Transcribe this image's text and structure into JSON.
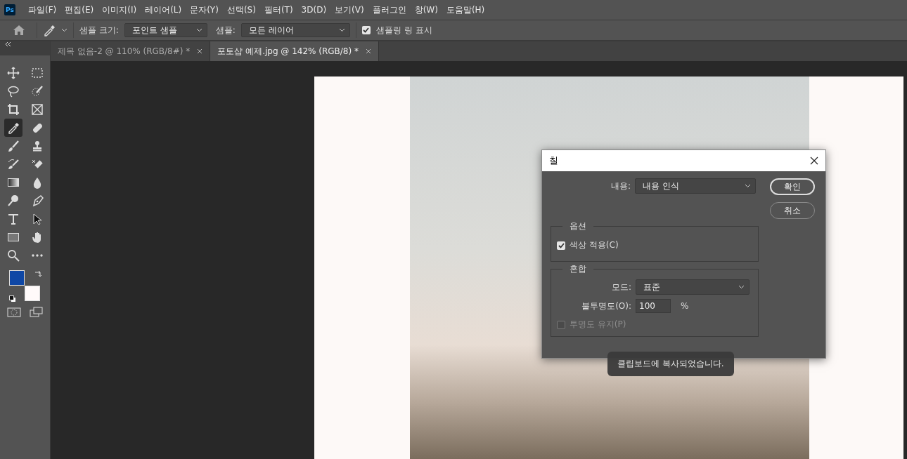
{
  "app_logo": "Ps",
  "menu": [
    "파일(F)",
    "편집(E)",
    "이미지(I)",
    "레이어(L)",
    "문자(Y)",
    "선택(S)",
    "필터(T)",
    "3D(D)",
    "보기(V)",
    "플러그인",
    "창(W)",
    "도움말(H)"
  ],
  "options_bar": {
    "sample_size_label": "샘플 크기:",
    "sample_size": "포인트 샘플",
    "sample_label": "샘플:",
    "sample": "모든 레이어",
    "show_ring": {
      "label": "샘플링 링 표시",
      "checked": true
    }
  },
  "tabs": [
    {
      "label": "제목 없음-2 @ 110% (RGB/8#) *",
      "selected": false
    },
    {
      "label": "포토샵 예제.jpg @ 142% (RGB/8) *",
      "selected": true
    }
  ],
  "tools": [
    {
      "kind": "move",
      "selected": false
    },
    {
      "kind": "marquee",
      "selected": false
    },
    {
      "kind": "lasso",
      "selected": false
    },
    {
      "kind": "quick-select",
      "selected": false
    },
    {
      "kind": "crop",
      "selected": false
    },
    {
      "kind": "frame",
      "selected": false
    },
    {
      "kind": "eyedropper",
      "selected": true
    },
    {
      "kind": "healing",
      "selected": false
    },
    {
      "kind": "brush",
      "selected": false
    },
    {
      "kind": "stamp",
      "selected": false
    },
    {
      "kind": "history-brush",
      "selected": false
    },
    {
      "kind": "eraser",
      "selected": false
    },
    {
      "kind": "gradient",
      "selected": false
    },
    {
      "kind": "blur",
      "selected": false
    },
    {
      "kind": "dodge",
      "selected": false
    },
    {
      "kind": "pen",
      "selected": false
    },
    {
      "kind": "type",
      "selected": false
    },
    {
      "kind": "path-select",
      "selected": false
    },
    {
      "kind": "shape",
      "selected": false
    },
    {
      "kind": "hand",
      "selected": false
    },
    {
      "kind": "zoom",
      "selected": false
    },
    {
      "kind": "more",
      "selected": false
    }
  ],
  "swatches": [
    {
      "kind": "foreground",
      "color": "#0f47a5"
    },
    {
      "kind": "background",
      "color": "#fffafa"
    }
  ],
  "dialog": {
    "title": "칠",
    "content_label": "내용:",
    "content": "내용 인식",
    "ok": "확인",
    "cancel": "취소",
    "options_group": {
      "title": "옵션",
      "color_adapt": {
        "label": "색상 적용(C)",
        "checked": true
      }
    },
    "blend_group": {
      "title": "혼합",
      "mode_label": "모드:",
      "mode": "표준",
      "opacity_label": "불투명도(O):",
      "opacity": "100",
      "opacity_unit": "%",
      "preserve": {
        "label": "투명도 유지(P)",
        "checked": false,
        "disabled": true
      }
    }
  },
  "toast": "클립보드에 복사되었습니다."
}
